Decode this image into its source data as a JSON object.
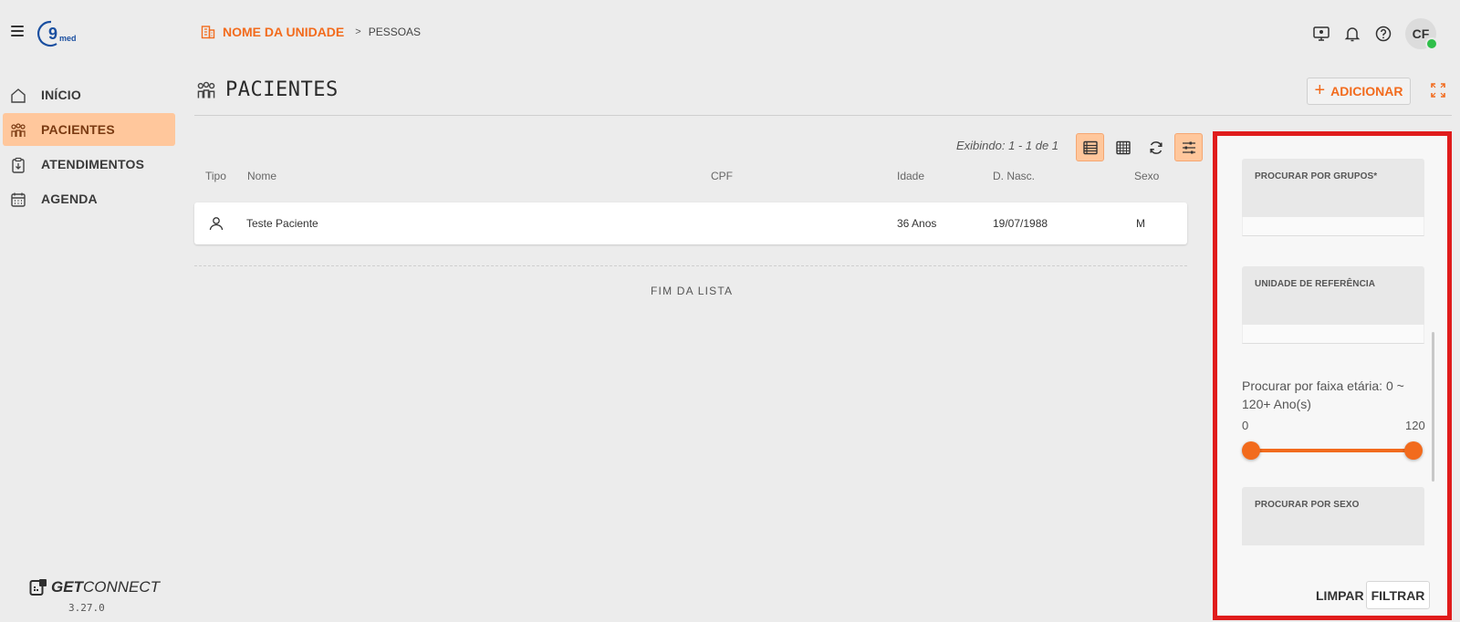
{
  "app": {
    "logo_text": "9med",
    "brand_bold": "GET",
    "brand_light": "CONNECT",
    "version": "3.27.0"
  },
  "sidebar": {
    "items": [
      {
        "label": "INÍCIO",
        "icon": "home-icon",
        "active": false
      },
      {
        "label": "PACIENTES",
        "icon": "people-icon",
        "active": true
      },
      {
        "label": "ATENDIMENTOS",
        "icon": "clipboard-icon",
        "active": false
      },
      {
        "label": "AGENDA",
        "icon": "calendar-icon",
        "active": false
      }
    ]
  },
  "header": {
    "unit": "NOME DA UNIDADE",
    "separator": ">",
    "page": "PESSOAS",
    "avatar_initials": "CF",
    "icons": [
      "monitor-icon",
      "bell-icon",
      "help-icon"
    ]
  },
  "page": {
    "title": "PACIENTES",
    "add_label": "ADICIONAR",
    "add_plus": "+"
  },
  "list": {
    "showing": "Exibindo: 1 - 1 de 1",
    "columns": [
      "Tipo",
      "Nome",
      "CPF",
      "Idade",
      "D. Nasc.",
      "Sexo"
    ],
    "rows": [
      {
        "nome": "Teste Paciente",
        "cpf": "",
        "idade": "36 Anos",
        "nasc": "19/07/1988",
        "sexo": "M"
      }
    ],
    "end_label": "FIM DA LISTA"
  },
  "filter": {
    "groups_label": "PROCURAR POR GRUPOS*",
    "unit_label": "UNIDADE DE REFERÊNCIA",
    "age_label": "Procurar por faixa etária: 0 ~ 120+ Ano(s)",
    "age_min": "0",
    "age_max": "120",
    "age_range": [
      0,
      120
    ],
    "sex_label": "PROCURAR POR SEXO",
    "clear_label": "LIMPAR",
    "filter_label": "FILTRAR"
  },
  "colors": {
    "accent": "#f26b1d",
    "active_bg": "#ffc79c",
    "highlight_border": "#e01c1c",
    "status_online": "#2fbf4a"
  }
}
